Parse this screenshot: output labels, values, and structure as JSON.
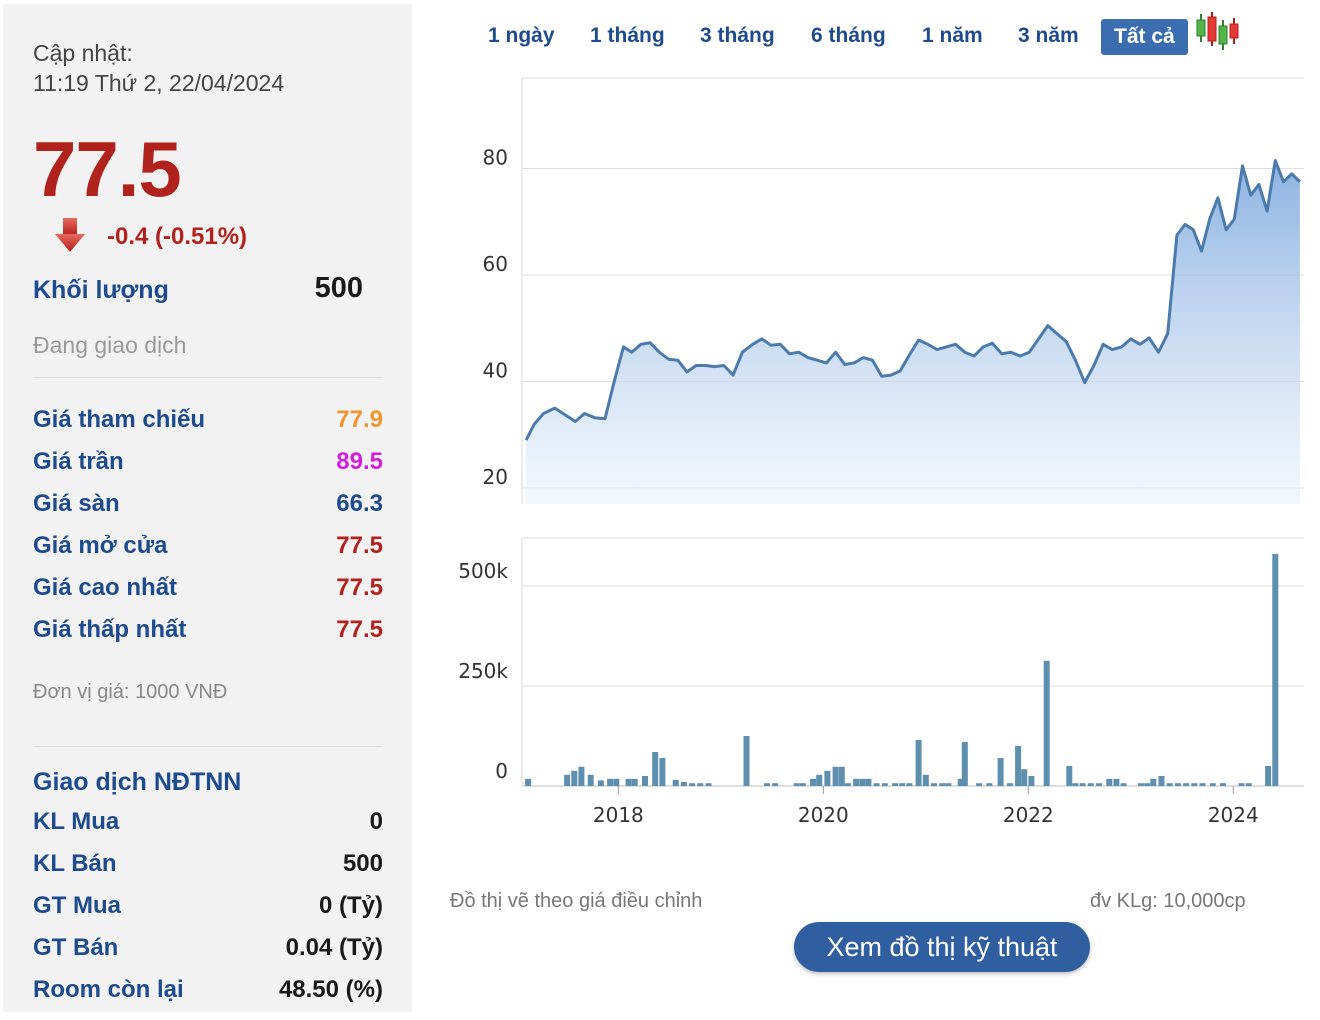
{
  "update": {
    "label": "Cập nhật:",
    "time": "11:19 Thứ 2, 22/04/2024"
  },
  "quote": {
    "price": "77.5",
    "change": "-0.4 (-0.51%)",
    "direction_icon": "down-arrow-icon",
    "volume_label": "Khối lượng",
    "volume_value": "500",
    "status": "Đang giao dịch"
  },
  "prices": [
    {
      "label": "Giá tham chiếu",
      "value": "77.9",
      "color": "#f0952c"
    },
    {
      "label": "Giá trần",
      "value": "89.5",
      "color": "#d21ed9"
    },
    {
      "label": "Giá sàn",
      "value": "66.3",
      "color": "#1e4b8e"
    },
    {
      "label": "Giá mở cửa",
      "value": "77.5",
      "color": "#b0221b"
    },
    {
      "label": "Giá cao nhất",
      "value": "77.5",
      "color": "#b0221b"
    },
    {
      "label": "Giá thấp nhất",
      "value": "77.5",
      "color": "#b0221b"
    }
  ],
  "unit_note": "Đơn vị giá: 1000 VNĐ",
  "foreign": {
    "title": "Giao dịch NĐTNN",
    "rows": [
      {
        "label": "KL Mua",
        "value": "0"
      },
      {
        "label": "KL Bán",
        "value": "500"
      },
      {
        "label": "GT Mua",
        "value": "0 (Tỷ)"
      },
      {
        "label": "GT Bán",
        "value": "0.04 (Tỷ)"
      },
      {
        "label": "Room còn lại",
        "value": "48.50 (%)"
      }
    ]
  },
  "range_tabs": [
    {
      "label": "1 ngày",
      "active": false
    },
    {
      "label": "1 tháng",
      "active": false
    },
    {
      "label": "3 tháng",
      "active": false
    },
    {
      "label": "6 tháng",
      "active": false
    },
    {
      "label": "1 năm",
      "active": false
    },
    {
      "label": "3 năm",
      "active": false
    },
    {
      "label": "Tất cả",
      "active": true
    }
  ],
  "chart_type_icon": "candlestick-icon",
  "colors": {
    "line": "#4b7aac",
    "volume_bar": "#5f8fae",
    "accent": "#2f5fa0",
    "price_red": "#b0221b"
  },
  "chart_data": {
    "type": "area",
    "x_ticks": [
      2018,
      2020,
      2022,
      2024
    ],
    "price": {
      "y_ticks": [
        20,
        40,
        60,
        80
      ],
      "ylim": [
        17,
        97
      ],
      "grid": true,
      "points": [
        [
          2017.1,
          29
        ],
        [
          2017.18,
          32
        ],
        [
          2017.27,
          34
        ],
        [
          2017.38,
          35
        ],
        [
          2017.5,
          33.5
        ],
        [
          2017.58,
          32.5
        ],
        [
          2017.67,
          34
        ],
        [
          2017.77,
          33.2
        ],
        [
          2017.87,
          33
        ],
        [
          2017.96,
          40
        ],
        [
          2018.05,
          46.5
        ],
        [
          2018.13,
          45.5
        ],
        [
          2018.22,
          47
        ],
        [
          2018.31,
          47.3
        ],
        [
          2018.4,
          45.5
        ],
        [
          2018.49,
          44.2
        ],
        [
          2018.58,
          44
        ],
        [
          2018.67,
          41.8
        ],
        [
          2018.76,
          43
        ],
        [
          2018.85,
          43
        ],
        [
          2018.94,
          42.8
        ],
        [
          2019.03,
          43
        ],
        [
          2019.12,
          41.2
        ],
        [
          2019.21,
          45.5
        ],
        [
          2019.31,
          47
        ],
        [
          2019.4,
          48
        ],
        [
          2019.49,
          46.8
        ],
        [
          2019.58,
          47
        ],
        [
          2019.67,
          45.2
        ],
        [
          2019.76,
          45.5
        ],
        [
          2019.85,
          44.5
        ],
        [
          2019.94,
          44
        ],
        [
          2020.03,
          43.5
        ],
        [
          2020.12,
          45.5
        ],
        [
          2020.21,
          43.2
        ],
        [
          2020.3,
          43.5
        ],
        [
          2020.39,
          44.5
        ],
        [
          2020.48,
          44
        ],
        [
          2020.57,
          41
        ],
        [
          2020.66,
          41.2
        ],
        [
          2020.75,
          42
        ],
        [
          2020.84,
          45
        ],
        [
          2020.93,
          47.8
        ],
        [
          2021.02,
          47
        ],
        [
          2021.11,
          46
        ],
        [
          2021.2,
          46.5
        ],
        [
          2021.29,
          47
        ],
        [
          2021.38,
          45.5
        ],
        [
          2021.47,
          44.8
        ],
        [
          2021.56,
          46.5
        ],
        [
          2021.65,
          47.2
        ],
        [
          2021.74,
          45.2
        ],
        [
          2021.83,
          45.5
        ],
        [
          2021.92,
          44.8
        ],
        [
          2022.01,
          45.5
        ],
        [
          2022.1,
          48
        ],
        [
          2022.19,
          50.5
        ],
        [
          2022.28,
          49
        ],
        [
          2022.37,
          47.5
        ],
        [
          2022.46,
          44
        ],
        [
          2022.55,
          39.8
        ],
        [
          2022.64,
          43
        ],
        [
          2022.73,
          47
        ],
        [
          2022.82,
          46
        ],
        [
          2022.91,
          46.5
        ],
        [
          2023.0,
          48
        ],
        [
          2023.09,
          47
        ],
        [
          2023.18,
          48.2
        ],
        [
          2023.27,
          45.5
        ],
        [
          2023.36,
          49
        ],
        [
          2023.45,
          67.5
        ],
        [
          2023.53,
          69.5
        ],
        [
          2023.61,
          68.5
        ],
        [
          2023.69,
          64.5
        ],
        [
          2023.77,
          70.5
        ],
        [
          2023.85,
          74.5
        ],
        [
          2023.93,
          68.5
        ],
        [
          2024.01,
          70.5
        ],
        [
          2024.09,
          80.5
        ],
        [
          2024.17,
          75
        ],
        [
          2024.25,
          77
        ],
        [
          2024.33,
          72
        ],
        [
          2024.41,
          81.5
        ],
        [
          2024.49,
          77.5
        ],
        [
          2024.57,
          79
        ],
        [
          2024.65,
          77.5
        ]
      ]
    },
    "volume": {
      "unit_note": "đv KLg: 10,000cp",
      "y_ticks": [
        0,
        250000,
        500000
      ],
      "y_tick_labels": [
        "0",
        "250k",
        "500k"
      ],
      "ylim": [
        0,
        620000
      ],
      "bars": [
        [
          2017.12,
          18000
        ],
        [
          2017.5,
          28000
        ],
        [
          2017.57,
          38000
        ],
        [
          2017.64,
          48000
        ],
        [
          2017.73,
          28000
        ],
        [
          2017.83,
          14000
        ],
        [
          2017.92,
          18000
        ],
        [
          2017.98,
          18000
        ],
        [
          2018.1,
          18000
        ],
        [
          2018.16,
          18000
        ],
        [
          2018.26,
          25000
        ],
        [
          2018.36,
          85000
        ],
        [
          2018.43,
          70000
        ],
        [
          2018.56,
          15000
        ],
        [
          2018.64,
          10000
        ],
        [
          2018.72,
          7000
        ],
        [
          2018.8,
          7000
        ],
        [
          2018.88,
          7000
        ],
        [
          2019.25,
          125000
        ],
        [
          2019.45,
          7000
        ],
        [
          2019.53,
          7000
        ],
        [
          2019.74,
          7000
        ],
        [
          2019.8,
          7000
        ],
        [
          2019.9,
          18000
        ],
        [
          2019.96,
          28000
        ],
        [
          2020.04,
          38000
        ],
        [
          2020.12,
          48000
        ],
        [
          2020.18,
          48000
        ],
        [
          2020.24,
          7000
        ],
        [
          2020.32,
          18000
        ],
        [
          2020.38,
          18000
        ],
        [
          2020.44,
          18000
        ],
        [
          2020.52,
          7000
        ],
        [
          2020.6,
          7000
        ],
        [
          2020.7,
          7000
        ],
        [
          2020.77,
          7000
        ],
        [
          2020.84,
          7000
        ],
        [
          2020.93,
          115000
        ],
        [
          2021.0,
          28000
        ],
        [
          2021.08,
          7000
        ],
        [
          2021.16,
          7000
        ],
        [
          2021.22,
          7000
        ],
        [
          2021.34,
          18000
        ],
        [
          2021.38,
          110000
        ],
        [
          2021.52,
          7000
        ],
        [
          2021.62,
          7000
        ],
        [
          2021.73,
          70000
        ],
        [
          2021.82,
          7000
        ],
        [
          2021.9,
          100000
        ],
        [
          2021.96,
          42000
        ],
        [
          2022.03,
          25000
        ],
        [
          2022.18,
          313000
        ],
        [
          2022.4,
          50000
        ],
        [
          2022.46,
          7000
        ],
        [
          2022.53,
          7000
        ],
        [
          2022.61,
          7000
        ],
        [
          2022.69,
          7000
        ],
        [
          2022.79,
          18000
        ],
        [
          2022.86,
          18000
        ],
        [
          2022.93,
          7000
        ],
        [
          2023.1,
          7000
        ],
        [
          2023.16,
          7000
        ],
        [
          2023.22,
          18000
        ],
        [
          2023.3,
          25000
        ],
        [
          2023.38,
          7000
        ],
        [
          2023.46,
          7000
        ],
        [
          2023.54,
          7000
        ],
        [
          2023.62,
          7000
        ],
        [
          2023.7,
          7000
        ],
        [
          2023.8,
          7000
        ],
        [
          2023.9,
          7000
        ],
        [
          2024.08,
          7000
        ],
        [
          2024.15,
          7000
        ],
        [
          2024.34,
          50000
        ],
        [
          2024.41,
          580000
        ]
      ]
    }
  },
  "footer": {
    "note": "Đồ thị vẽ theo giá điều chỉnh",
    "volume_unit": "đv KLg: 10,000cp",
    "tech_button": "Xem đồ thị kỹ thuật"
  }
}
